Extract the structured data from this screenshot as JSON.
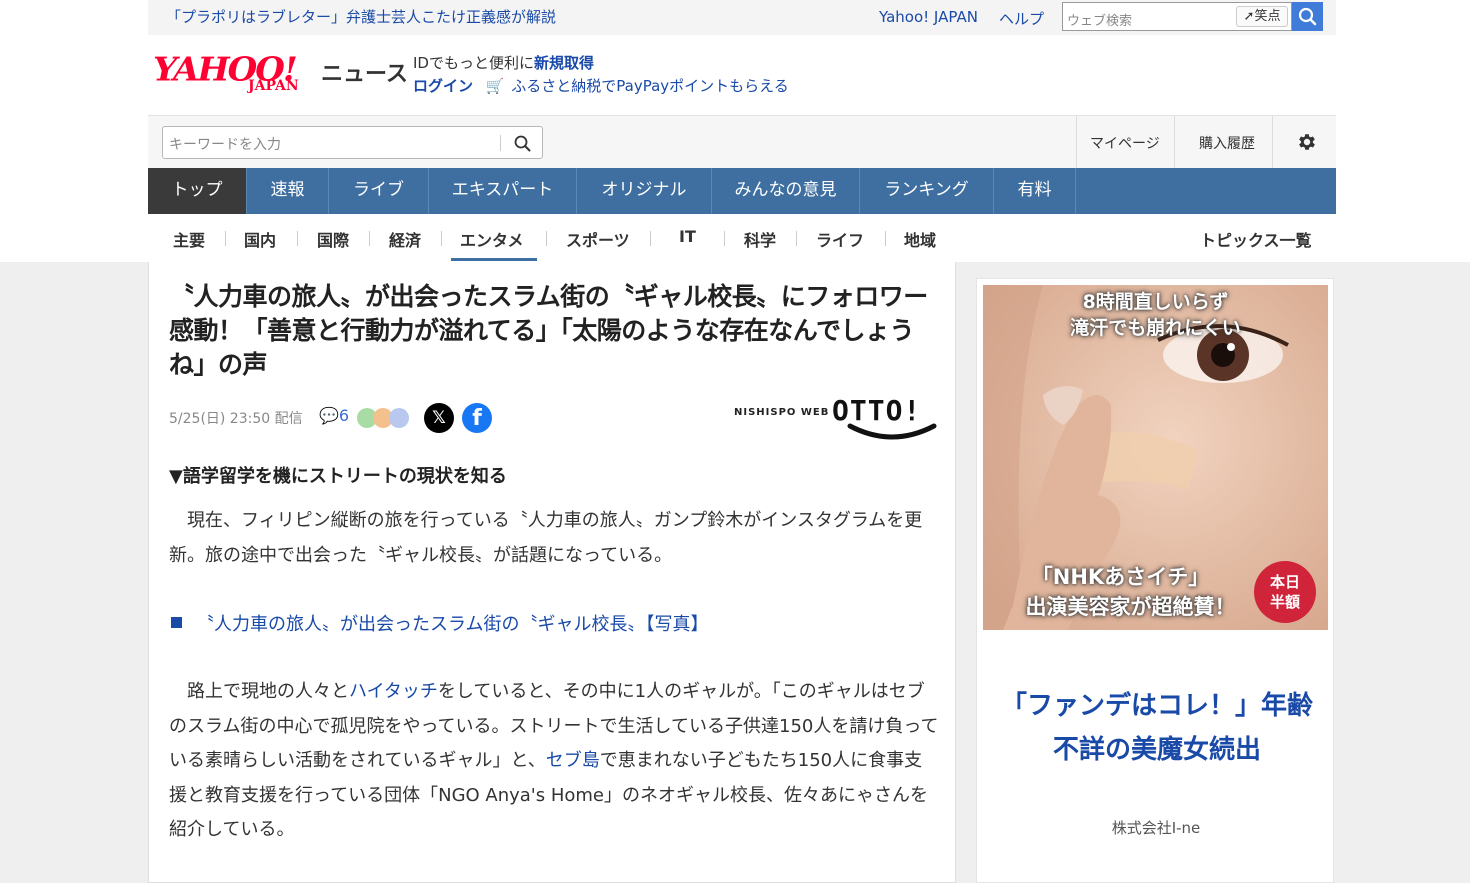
{
  "topstrip": {
    "headline": "「プラポリはラブレター」弁護士芸人こたけ正義感が解説",
    "yahoo_japan": "Yahoo! JAPAN",
    "help": "ヘルプ",
    "web_search_placeholder": "ウェブ検索",
    "emi_label": "笑点"
  },
  "header": {
    "logo_yahoo": "YAHOO!",
    "logo_japan": "JAPAN",
    "news_label": "ニュース",
    "id_text": "IDでもっと便利に",
    "id_link": "新規取得",
    "login": "ログイン",
    "furusato": "ふるさと納税でPayPayポイントもらえる"
  },
  "searchbar": {
    "keyword_placeholder": "キーワードを入力",
    "mypage": "マイページ",
    "purchase_history": "購入履歴"
  },
  "main_nav": {
    "items": [
      "トップ",
      "速報",
      "ライブ",
      "エキスパート",
      "オリジナル",
      "みんなの意見",
      "ランキング",
      "有料"
    ],
    "active": "トップ"
  },
  "sub_nav": {
    "items": [
      "主要",
      "国内",
      "国際",
      "経済",
      "エンタメ",
      "スポーツ",
      "IT",
      "科学",
      "ライフ",
      "地域"
    ],
    "active": "エンタメ",
    "topics_all": "トピックス一覧"
  },
  "article": {
    "title": "〝人力車の旅人〟が出会ったスラム街の〝ギャル校長〟にフォロワー感動！「善意と行動力が溢れてる」「太陽のような存在なんでしょうね」の声",
    "date": "5/25(日) 23:50 配信",
    "comment_count": "6",
    "publisher_small": "NISHISPO WEB",
    "publisher_logo": "OTTO!",
    "subheading": "▼語学留学を機にストリートの現状を知る",
    "para1": "現在、フィリピン縦断の旅を行っている〝人力車の旅人〟ガンプ鈴木がインスタグラムを更新。旅の途中で出会った〝ギャル校長〟が話題になっている。",
    "photo_link": "〝人力車の旅人〟が出会ったスラム街の〝ギャル校長〟【写真】",
    "para2_pre": "路上で現地の人々と",
    "para2_link1": "ハイタッチ",
    "para2_mid": "をしていると、その中に1人のギャルが。「このギャルはセブのスラム街の中心で孤児院をやっている。ストリートで生活している子供達150人を請け負っている素晴らしい活動をされているギャル」と、",
    "para2_link2": "セブ島",
    "para2_post": "で恵まれない子どもたち150人に食事支援と教育支援を行っている団体「NGO Anya's Home」のネオギャル校長、佐々あにゃさんを紹介している。"
  },
  "ad": {
    "img_text1": "8時間直しいらず",
    "img_text2": "滝汗でも崩れにくい",
    "img_text3": "「NHKあさイチ」",
    "img_text4": "出演美容家が超絶賛！",
    "badge_line1": "本日",
    "badge_line2": "半額",
    "headline": "「ファンデはコレ！」年齢不詳の美魔女続出",
    "sponsor": "株式会社I-ne"
  },
  "colors": {
    "nav_blue": "#3e6fa0",
    "nav_active": "#3a3a3a",
    "link_blue": "#1a4aa8",
    "yahoo_red": "#ff0033"
  }
}
